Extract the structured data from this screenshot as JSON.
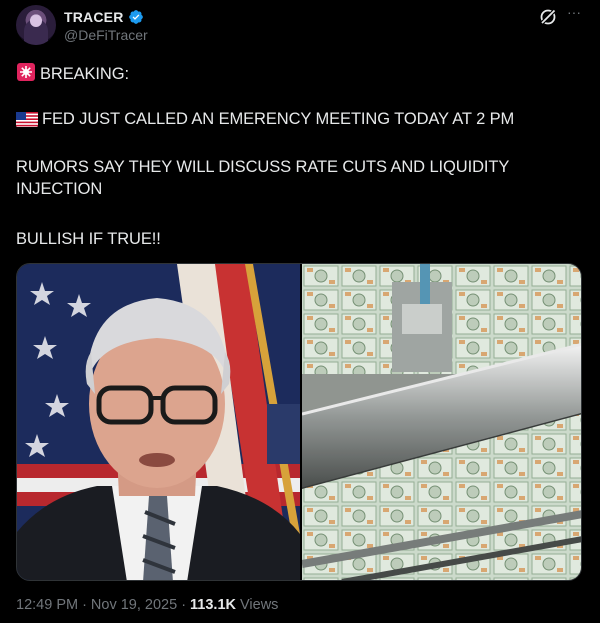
{
  "post": {
    "author": {
      "display_name": "TRACER",
      "handle": "@DeFiTracer",
      "verified": true,
      "verified_color": "#1d9bf0"
    },
    "lines": {
      "breaking": "BREAKING:",
      "headline": "FED JUST CALLED AN EMERENCY MEETING TODAY AT 2 PM",
      "rumors": "RUMORS SAY THEY WILL DISCUSS RATE CUTS AND LIQUIDITY INJECTION",
      "bullish": "BULLISH IF TRUE!!"
    },
    "emojis": {
      "breaking": "rotating-light-icon",
      "headline": "us-flag-icon"
    },
    "media": {
      "left": "man-speaking-at-podium-photo",
      "right": "money-printing-press-photo"
    },
    "meta": {
      "time": "12:49 PM",
      "separator": "·",
      "date": "Nov 19, 2025",
      "views_count": "113.1K",
      "views_label": "Views"
    }
  }
}
